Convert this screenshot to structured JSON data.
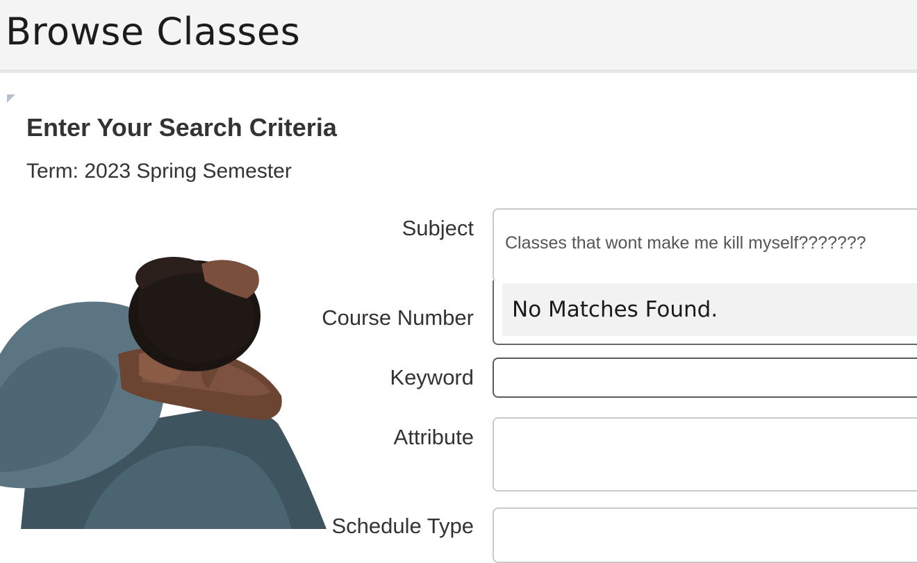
{
  "header": {
    "title": "Browse Classes"
  },
  "search": {
    "heading": "Enter Your Search Criteria",
    "term": "Term: 2023 Spring Semester"
  },
  "fields": {
    "subject": {
      "label": "Subject",
      "value": "Classes that wont make me kill myself???????"
    },
    "subject_dropdown": {
      "message": "No Matches Found."
    },
    "course_number": {
      "label": "Course Number"
    },
    "keyword": {
      "label": "Keyword",
      "value": ""
    },
    "attribute": {
      "label": "Attribute"
    },
    "schedule_type": {
      "label": "Schedule Type"
    }
  }
}
